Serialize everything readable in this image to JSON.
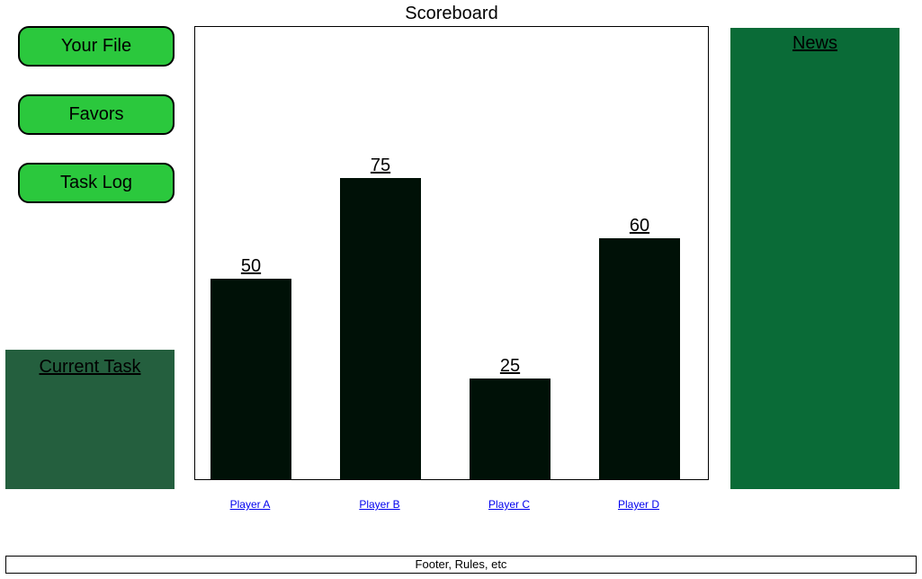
{
  "title": "Scoreboard",
  "sidebar": {
    "buttons": [
      {
        "label": "Your File"
      },
      {
        "label": "Favors"
      },
      {
        "label": "Task Log"
      }
    ],
    "current_task_label": "Current Task"
  },
  "news": {
    "label": "News"
  },
  "footer": "Footer, Rules, etc",
  "chart_data": {
    "type": "bar",
    "title": "Scoreboard",
    "xlabel": "",
    "ylabel": "",
    "ylim": [
      0,
      113
    ],
    "categories": [
      "Player A",
      "Player B",
      "Player C",
      "Player D"
    ],
    "values": [
      50,
      75,
      25,
      60
    ]
  }
}
